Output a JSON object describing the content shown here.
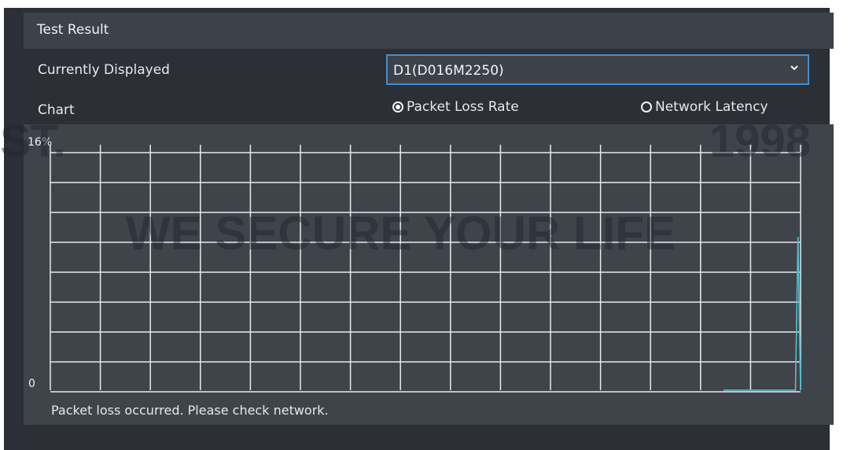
{
  "header": {
    "title": "Test Result"
  },
  "display": {
    "label": "Currently Displayed",
    "selected": "D1(D016M2250)"
  },
  "chart_row": {
    "label": "Chart",
    "options": [
      {
        "label": "Packet Loss Rate",
        "selected": true
      },
      {
        "label": "Network Latency",
        "selected": false
      }
    ]
  },
  "chart": {
    "y_max_label": "16%",
    "y_min_label": "0"
  },
  "status": {
    "message": "Packet loss occurred. Please check network."
  },
  "watermark": {
    "line1": "WE SECURE YOUR LIFE",
    "left": "ST.",
    "right": "1998"
  },
  "colors": {
    "grid": "#e8eaed",
    "series_red": "#d0455c",
    "series_cyan": "#43c7d6",
    "accent": "#3b8fd6"
  },
  "chart_data": {
    "type": "line",
    "ylim": [
      0,
      16
    ],
    "yticks": [
      "0",
      "16%"
    ],
    "grid": true,
    "x": [
      1,
      2,
      3,
      4,
      5,
      6,
      7,
      8,
      9,
      10,
      11,
      12,
      13,
      14,
      15,
      16,
      17,
      18,
      19,
      20,
      21,
      22,
      23,
      24,
      25,
      26,
      27,
      28,
      29,
      30,
      31
    ],
    "series": [
      {
        "color": "#d0455c",
        "values": [
          0,
          0,
          0,
          0,
          0,
          0,
          0,
          0,
          0,
          0,
          0,
          0,
          0,
          0,
          0,
          0,
          0,
          0,
          0,
          0,
          0,
          0,
          0,
          0,
          0,
          0,
          0,
          0,
          0,
          10,
          0
        ]
      },
      {
        "color": "#43c7d6",
        "values": [
          0,
          0,
          0,
          0,
          0,
          0,
          0,
          0,
          0,
          0,
          0,
          0,
          0,
          0,
          0,
          0,
          0,
          0,
          0,
          0,
          0,
          0,
          0,
          0,
          0,
          0,
          0,
          0,
          0,
          10,
          0
        ]
      }
    ]
  }
}
